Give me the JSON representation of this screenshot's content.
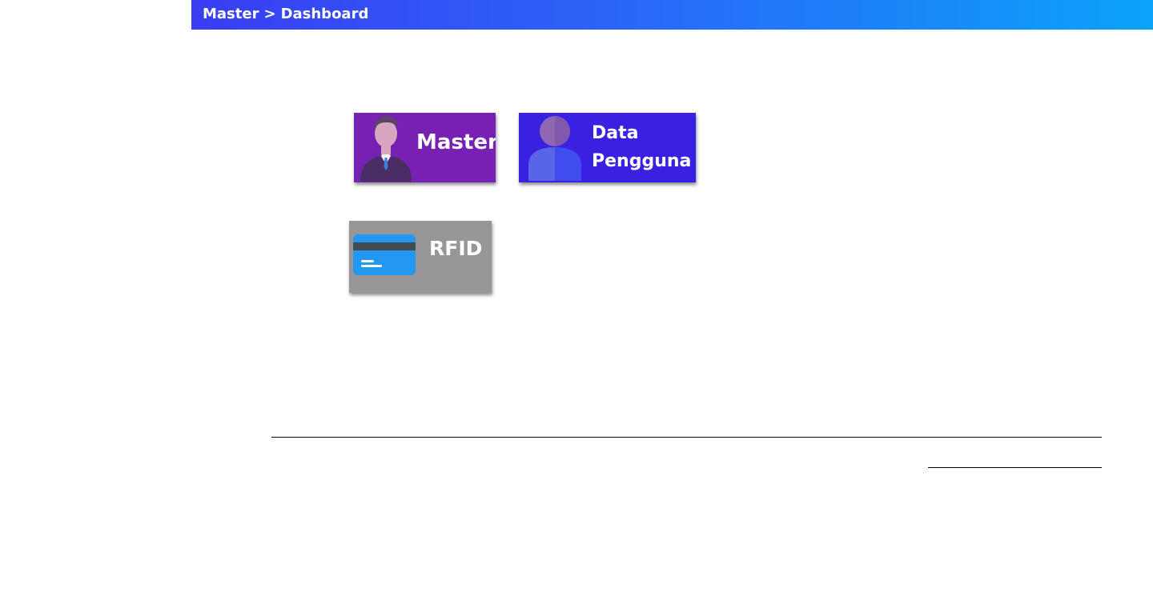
{
  "header": {
    "breadcrumb": {
      "root": "Master",
      "separator": ">",
      "current": "Dashboard"
    },
    "gradient_colors": [
      "#3a3df2",
      "#0ba3f9"
    ]
  },
  "tiles": [
    {
      "label": "Master",
      "icon": "businessman-icon",
      "color": "#7620b4"
    },
    {
      "label_line1": "Data",
      "label_line2": "Pengguna",
      "icon": "user-icon",
      "color": "#3a20e0"
    },
    {
      "label": "RFID",
      "icon": "credit-card-icon",
      "color": "#99969a"
    }
  ]
}
